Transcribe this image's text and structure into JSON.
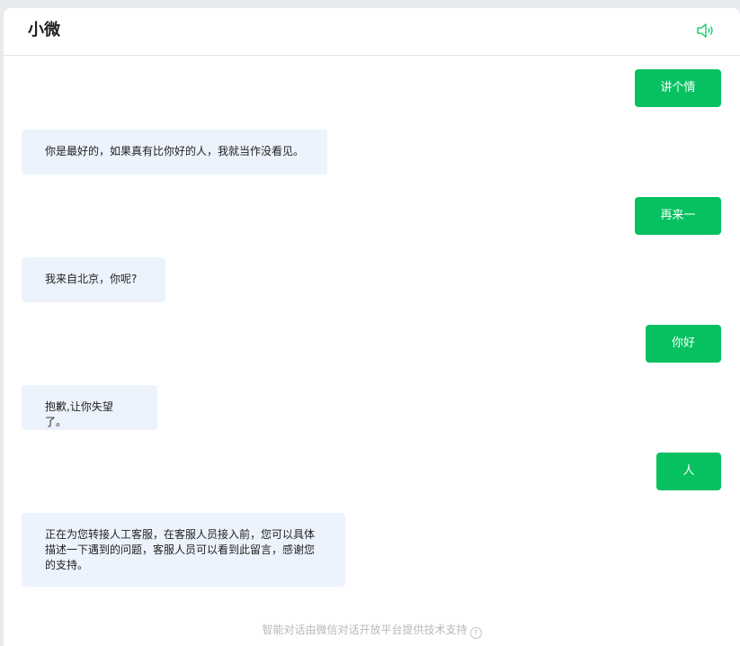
{
  "header": {
    "title": "小微",
    "speaker_icon": "speaker-icon"
  },
  "messages": [
    {
      "role": "user",
      "text": "讲个情话"
    },
    {
      "role": "bot",
      "text": "你是最好的，如果真有比你好的人，我就当作没看见。"
    },
    {
      "role": "user",
      "text": "再来一个"
    },
    {
      "role": "bot",
      "text": "我来自北京，你呢?"
    },
    {
      "role": "user",
      "text": "你好蠢"
    },
    {
      "role": "bot",
      "text": "抱歉,让你失望了。"
    },
    {
      "role": "user",
      "text": "人工"
    },
    {
      "role": "bot",
      "text": "正在为您转接人工客服，在客服人员接入前，您可以具体描述一下遇到的问题，客服人员可以看到此留言，感谢您的支持。"
    }
  ],
  "footer": {
    "text": "智能对话由微信对话开放平台提供技术支持",
    "help_icon": "help-icon",
    "help_glyph": "?"
  },
  "colors": {
    "user_bubble": "#07c160",
    "bot_bubble": "#edf3fd",
    "accent": "#07c160"
  }
}
